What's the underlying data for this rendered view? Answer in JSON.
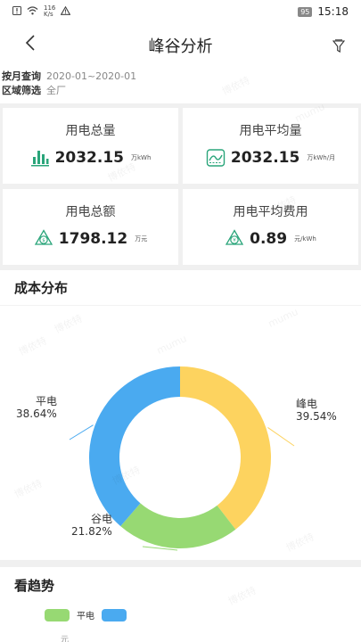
{
  "status_bar": {
    "speed_top": "116",
    "speed_bottom": "K/s",
    "battery": "95",
    "time": "15:18"
  },
  "nav": {
    "title": "峰谷分析",
    "back_icon": "chevron-left-icon",
    "filter_icon": "filter-icon"
  },
  "query": {
    "month_label": "按月查询",
    "month_value": "2020-01~2020-01",
    "area_label": "区域筛选",
    "area_value": "全厂"
  },
  "cards": [
    {
      "label": "用电总量",
      "value": "2032.15",
      "unit": "万kWh",
      "icon": "bar-chart-icon"
    },
    {
      "label": "用电平均量",
      "value": "2032.15",
      "unit": "万kWh/月",
      "icon": "wave-chart-icon"
    },
    {
      "label": "用电总额",
      "value": "1798.12",
      "unit": "万元",
      "icon": "money-cycle-icon"
    },
    {
      "label": "用电平均费用",
      "value": "0.89",
      "unit": "元/kWh",
      "icon": "yen-cycle-icon"
    }
  ],
  "cost_section": {
    "title": "成本分布"
  },
  "chart_data": {
    "type": "pie",
    "donut": true,
    "categories": [
      "峰电",
      "谷电",
      "平电"
    ],
    "values": [
      39.54,
      21.82,
      38.64
    ],
    "labels": [
      "39.54%",
      "21.82%",
      "38.64%"
    ],
    "colors": [
      "#fdd35f",
      "#97d973",
      "#4aaaf0"
    ]
  },
  "trend_section": {
    "title": "看趋势",
    "legend": [
      {
        "name": "平电",
        "color": "#97d973"
      },
      {
        "name": "",
        "color": "#4aaaf0"
      }
    ],
    "y_unit": "元"
  },
  "watermark": [
    "博依特",
    "mumu"
  ],
  "accent": "#2aa57a"
}
